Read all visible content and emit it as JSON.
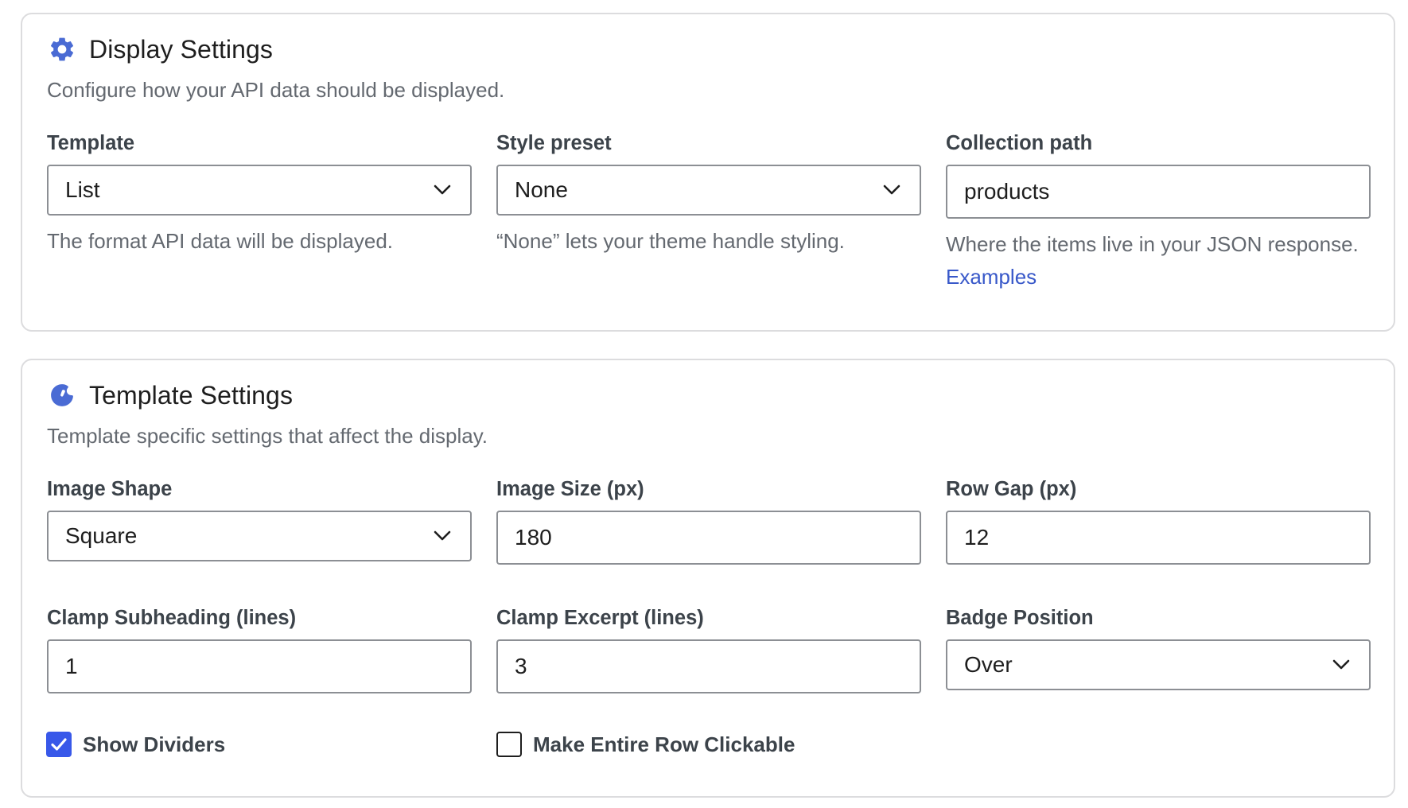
{
  "display_settings": {
    "title": "Display Settings",
    "icon": "gear-icon",
    "description": "Configure how your API data should be displayed.",
    "template": {
      "label": "Template",
      "value": "List",
      "help": "The format API data will be displayed."
    },
    "style_preset": {
      "label": "Style preset",
      "value": "None",
      "help": "“None” lets your theme handle styling."
    },
    "collection_path": {
      "label": "Collection path",
      "value": "products",
      "help": "Where the items live in your JSON response.",
      "help_link": "Examples"
    }
  },
  "template_settings": {
    "title": "Template Settings",
    "icon": "color-palette-icon",
    "description": "Template specific settings that affect the display.",
    "image_shape": {
      "label": "Image Shape",
      "value": "Square"
    },
    "image_size": {
      "label": "Image Size (px)",
      "value": "180"
    },
    "row_gap": {
      "label": "Row Gap (px)",
      "value": "12"
    },
    "clamp_subheading": {
      "label": "Clamp Subheading (lines)",
      "value": "1"
    },
    "clamp_excerpt": {
      "label": "Clamp Excerpt (lines)",
      "value": "3"
    },
    "badge_position": {
      "label": "Badge Position",
      "value": "Over"
    },
    "show_dividers": {
      "label": "Show Dividers",
      "checked": true
    },
    "row_clickable": {
      "label": "Make Entire Row Clickable",
      "checked": false
    }
  },
  "colors": {
    "accent": "#3858e9",
    "icon": "#4a6bd4",
    "link": "#3858c9",
    "border": "#8c8f94",
    "muted_text": "#646970"
  }
}
